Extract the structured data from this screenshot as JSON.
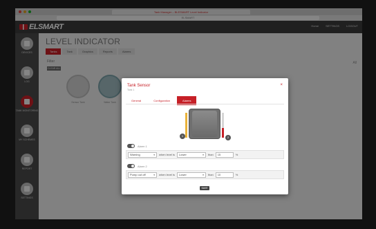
{
  "browser": {
    "tab_title": "Tank Manager – BLESMART Level Indicator",
    "url": "ELSMART"
  },
  "header": {
    "logo_text": "ELSMART",
    "links": [
      "Home",
      "SETTINGS",
      "LOGOUT"
    ]
  },
  "sidebar": {
    "items": [
      {
        "label": "DEVICES",
        "icon": "bell-icon"
      },
      {
        "label": "LOG",
        "icon": "log-icon"
      },
      {
        "label": "TANK MONITORING",
        "icon": "tank-icon",
        "active": true
      },
      {
        "label": "MY SCHEMES",
        "icon": "scheme-icon"
      },
      {
        "label": "REPORT",
        "icon": "report-icon"
      },
      {
        "label": "SETTINGS",
        "icon": "settings-icon"
      }
    ]
  },
  "main": {
    "title": "LEVEL INDICATOR",
    "tabs": [
      "Tanks",
      "Tank",
      "Graphics",
      "Reports",
      "Alarms"
    ],
    "filter_label": "Filter",
    "filter_chip": "CLEAR ALL",
    "corner_text": "All",
    "sensors": [
      "Sensor Tank",
      "Water Tank"
    ]
  },
  "modal": {
    "title": "Tank Sensor",
    "subtitle": "Tank 1",
    "close": "×",
    "tabs": [
      {
        "label": "General",
        "active": false
      },
      {
        "label": "Configuration",
        "active": false
      },
      {
        "label": "Alarms",
        "active": true
      }
    ],
    "tank_markers": {
      "left": "1",
      "right": "2"
    },
    "alarm1": {
      "toggle_label": "Alarm 1",
      "enabled": true,
      "action": "Warning",
      "mid_text": "when level is",
      "condition": "Lower",
      "than_text": "than",
      "value": "15",
      "unit": "%"
    },
    "alarm2": {
      "toggle_label": "Alarm 2",
      "enabled": true,
      "action": "Pump out off",
      "mid_text": "when level is",
      "condition": "Lower",
      "than_text": "than",
      "value": "10",
      "unit": "%"
    },
    "save_label": "SAVE"
  },
  "colors": {
    "accent": "#c62027",
    "header_bg": "#3b3b3b",
    "sidebar_bg": "#4a4a4a",
    "rail_left": "#e9b23a"
  }
}
